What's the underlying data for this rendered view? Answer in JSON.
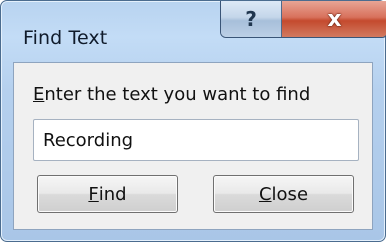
{
  "window": {
    "title": "Find Text",
    "help_glyph": "?",
    "close_glyph": "x"
  },
  "dialog": {
    "prompt_access_key": "E",
    "prompt_rest": "nter the text you want to find",
    "search_value": "Recording",
    "find_button": {
      "access_key": "F",
      "rest": "ind"
    },
    "close_button": {
      "access_key": "C",
      "rest": "lose"
    }
  },
  "icons": {
    "help": "question-mark-icon",
    "close": "close-icon"
  },
  "colors": {
    "frame": "#b8d3f0",
    "close_button": "#c44a2e",
    "client": "#f0f0f0"
  }
}
